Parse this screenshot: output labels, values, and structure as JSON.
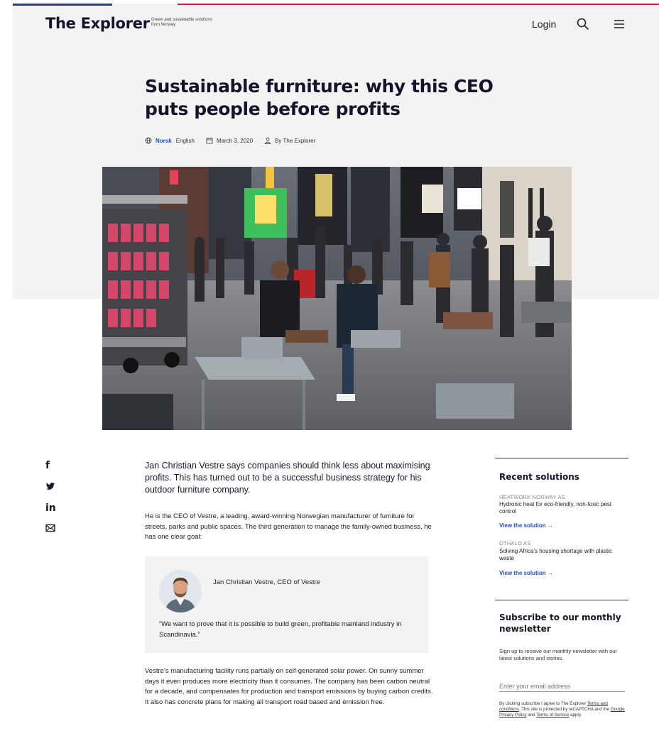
{
  "header": {
    "brand": "The Explorer",
    "tagline": "Green and sustainable solutions from Norway",
    "login_label": "Login",
    "search_icon": "search-icon",
    "menu_icon": "hamburger-menu-icon"
  },
  "article": {
    "title": "Sustainable furniture: why this CEO puts people before profits",
    "meta": {
      "language_active": "Norsk",
      "language_other": "English",
      "date": "March 3, 2020",
      "author": "By The Explorer"
    },
    "lead": "Jan Christian Vestre says companies should think less about maximising profits. This has turned out to be a successful business strategy for his outdoor furniture company.",
    "paragraph_1": "He is the CEO of Vestre, a leading, award-winning Norwegian manufacturer of furniture for streets, parks and public spaces. The third generation to manage the family-owned business, he has one clear goal:",
    "quote": {
      "name": "Jan Christian Vestre, CEO of Vestre",
      "text": "“We want to prove that it is possible to build green, profitable mainland industry in Scandinavia.”"
    },
    "paragraph_2": "Vestre’s manufacturing facility runs partially on self-generated solar power. On sunny summer days it even produces more electricity than it consumes. The company has been carbon neutral for a decade, and compensates for production and transport emissions by buying carbon credits. It also has concrete plans for making all transport road based and emission free."
  },
  "social": {
    "facebook": "f",
    "twitter_icon": "twitter-icon",
    "linkedin": "in",
    "email_icon": "mail-icon"
  },
  "sidebar": {
    "recent_heading": "Recent solutions",
    "solutions": [
      {
        "company": "HEATWORK NORWAY AS",
        "title": "Hydronic heat for eco-friendly, non-toxic pest control",
        "link": "View the solution →"
      },
      {
        "company": "OTHALO AS",
        "title": "Solving Africa's housing shortage with plastic waste",
        "link": "View the solution →"
      }
    ],
    "newsletter": {
      "heading": "Subscribe to our monthly newsletter",
      "description": "Sign up to receive our monthly newsletter with our latest solutions and stories.",
      "email_placeholder": "Enter your email address",
      "legal_1": "By clicking subscribe I agree to The Explorer",
      "terms_link": "Terms and conditions",
      "legal_2": ". This site is protected by reCAPTCHA and the",
      "privacy_link": "Google Privacy Policy",
      "legal_3": "and",
      "tos_link": "Terms of Service",
      "legal_4": "apply."
    }
  },
  "colors": {
    "accent_blue": "#1f4fc8",
    "top_bar_blue": "#1f3f8f",
    "top_bar_red": "#c8283c",
    "hero_background": "#f3f3f3"
  }
}
